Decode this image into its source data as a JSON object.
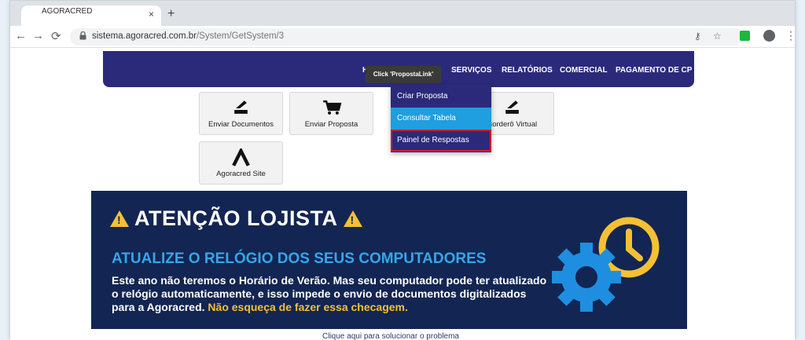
{
  "browser": {
    "tab_title": "AGORACRED",
    "tab_close": "×",
    "new_tab": "+",
    "back": "←",
    "forward": "→",
    "reload": "⟳",
    "url_domain": "sistema.agoracred.com.br",
    "url_path": "/System/GetSystem/3",
    "key_icon": "⚷",
    "star_icon": "☆",
    "menu_icon": "⋮"
  },
  "nav": {
    "items": [
      {
        "label": "H"
      },
      {
        "label": "SERVIÇOS"
      },
      {
        "label": "RELATÓRIOS"
      },
      {
        "label": "COMERCIAL"
      },
      {
        "label": "PAGAMENTO DE CP"
      }
    ]
  },
  "tooltip": "Click 'PropostaLink'",
  "dropdown": {
    "items": [
      {
        "label": "Criar Proposta"
      },
      {
        "label": "Consultar Tabela"
      },
      {
        "label": "Painel de Respostas"
      }
    ]
  },
  "tiles": [
    {
      "label": "Enviar Documentos",
      "icon": "scanner-icon",
      "glyph": "⌁"
    },
    {
      "label": "Enviar Proposta",
      "icon": "cart-icon",
      "glyph": "🛒"
    },
    {
      "label": "Borderô Virtual",
      "icon": "scanner-icon",
      "glyph": "⌁"
    },
    {
      "label": "Agoracred Site",
      "icon": "agoracred-logo-icon",
      "glyph": "Λ"
    }
  ],
  "banner": {
    "title": "ATENÇÃO LOJISTA",
    "subtitle": "ATUALIZE O RELÓGIO DOS SEUS COMPUTADORES",
    "body": "Este ano não teremos o Horário de Verão. Mas seu computador pode ter atualizado o relógio automaticamente, e isso impede o envio de documentos digitalizados para a Agoracred.",
    "highlight": "Não esqueça de fazer essa checagem."
  },
  "bottom_link": "Clique aqui para solucionar o problema",
  "colors": {
    "nav_bg": "#2b2a7a",
    "highlight_blue": "#1f9ee0",
    "outline_red": "#d21b2a",
    "banner_bg": "#132552",
    "banner_accent": "#36a6ea",
    "banner_yellow": "#f5c033"
  }
}
